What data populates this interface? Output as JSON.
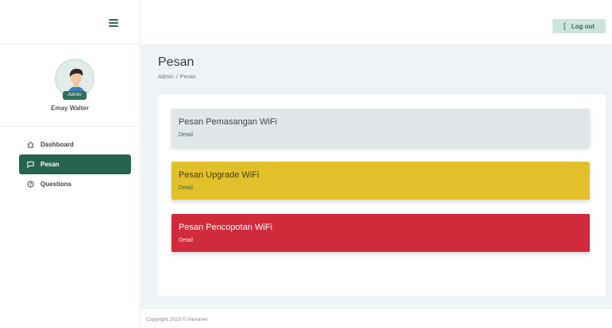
{
  "sidebar": {
    "profile": {
      "badge": "Admin",
      "name": "Emay Walter"
    },
    "items": [
      {
        "label": "Dashboard",
        "icon": "home-icon"
      },
      {
        "label": "Pesan",
        "icon": "message-icon",
        "active": true
      },
      {
        "label": "Questions",
        "icon": "question-icon"
      }
    ]
  },
  "topbar": {
    "logout_icon": "[",
    "logout_label": "Log out"
  },
  "page": {
    "title": "Pesan",
    "breadcrumb": [
      "Admin",
      "/",
      "Pesan"
    ]
  },
  "messages": [
    {
      "title": "Pesan Pemasangan WiFi",
      "link": "Detail",
      "color": "#e1e6e9"
    },
    {
      "title": "Pesan Upgrade WiFi",
      "link": "Detail",
      "color": "#e2c02c"
    },
    {
      "title": "Pesan Pencopotan WiFi",
      "link": "Detail",
      "color": "#cf2b3b"
    }
  ],
  "footer": {
    "text": "Copyright 2023 © Alexanet"
  },
  "colors": {
    "accent": "#27644f",
    "background": "#eff3f7"
  }
}
